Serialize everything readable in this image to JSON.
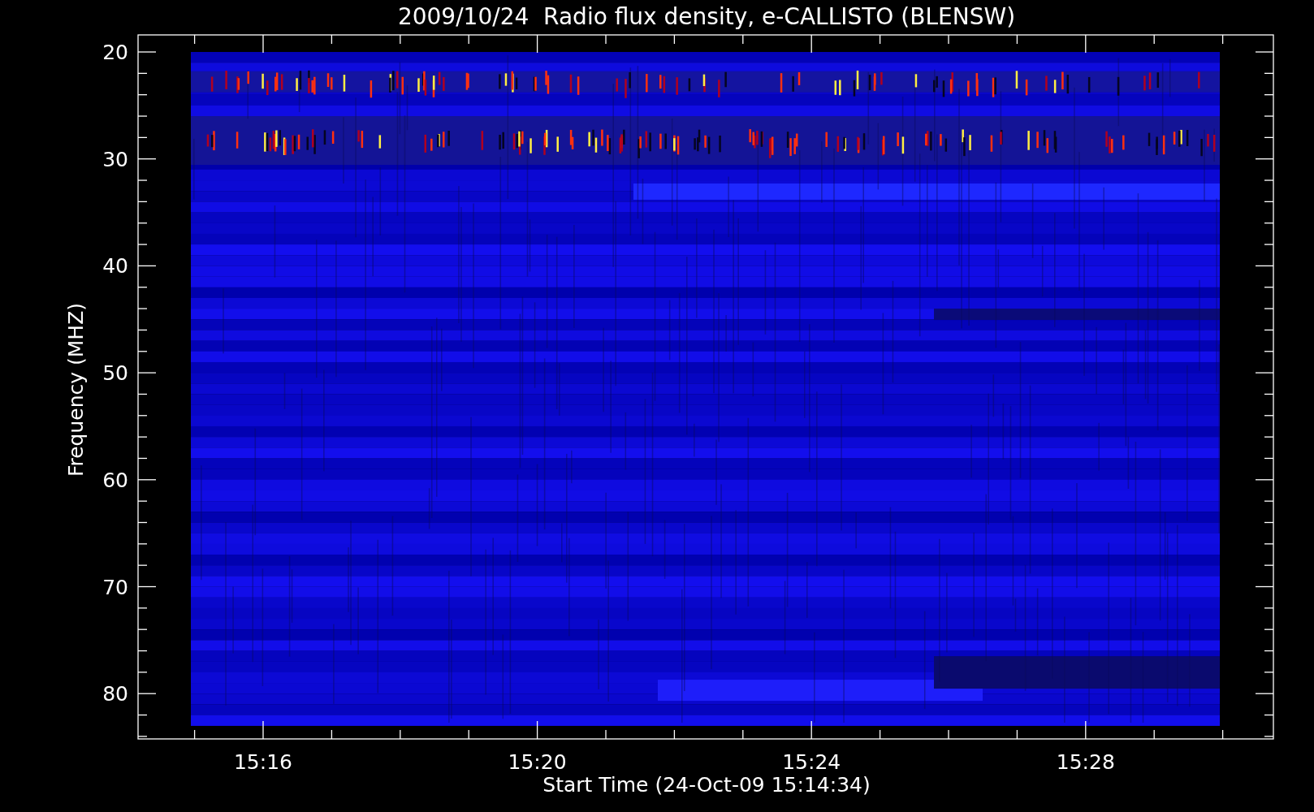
{
  "plot": {
    "title": "2009/10/24  Radio flux density, e-CALLISTO (BLENSW)",
    "ylabel": "Frequency (MHZ)",
    "xlabel": "Start Time (24-Oct-09 15:14:34)",
    "yticks": [
      "20",
      "30",
      "40",
      "50",
      "60",
      "70",
      "80"
    ],
    "xticks": [
      "15:16",
      "15:20",
      "15:24",
      "15:28"
    ]
  }
}
